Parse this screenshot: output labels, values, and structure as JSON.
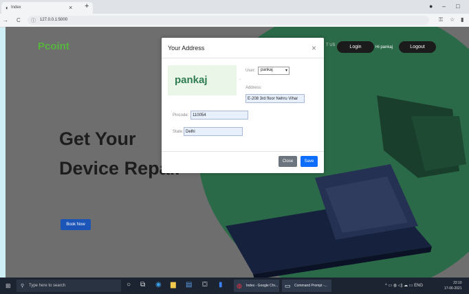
{
  "browser": {
    "tab_title": "Index",
    "url": "127.0.0.1:5000"
  },
  "site": {
    "brand": "Pcoint",
    "nav_text": "T US",
    "login_label": "Login",
    "greeting": "Hi pankaj",
    "logout_label": "Logout",
    "hero_line1": "Get Your",
    "hero_line2": "Device Repair",
    "book_now_label": "Book Now",
    "colors": {
      "brand_green": "#56b53c",
      "circle_green": "#2b6a48",
      "primary_blue": "#0d6efd"
    }
  },
  "modal": {
    "title": "Your Address",
    "user_display": "pankaj",
    "user_label": "User:",
    "user_selected": "pankaj",
    "address_label": "Address:",
    "address_value": "E-208 3rd floor Nehru Vihar",
    "pincode_label": "Pincode:",
    "pincode_value": "110054",
    "state_label": "State:",
    "state_value": "Delhi",
    "close_label": "Close",
    "save_label": "Save"
  },
  "taskbar": {
    "search_placeholder": "Type here to search",
    "app1_label": "Index - Google Chr...",
    "app2_label": "Command Prompt -...",
    "lang": "ENG",
    "time": "22:10",
    "date": "17-06-2021"
  }
}
